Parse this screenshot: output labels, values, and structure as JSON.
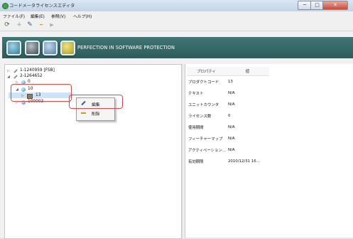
{
  "window": {
    "title": "コードメータライセンスエディタ",
    "min": "─",
    "max": "□",
    "close": "✕"
  },
  "menu": [
    {
      "label": "ファイル(F)"
    },
    {
      "label": "編集(E)"
    },
    {
      "label": "参照(V)"
    },
    {
      "label": "ヘルプ(H)"
    }
  ],
  "toolbar": {
    "refresh": "⟳",
    "add": "+",
    "edit": "✎",
    "remove": "━",
    "run": "▶"
  },
  "banner": {
    "tagline": "PERFECTION IN SOFTWARE PROTECTION",
    "icons": [
      "cmcontainer-icon",
      "firm-item-icon",
      "product-item-icon",
      "settings-icon"
    ]
  },
  "tree": [
    {
      "label": "1-1240959 [FSB]"
    },
    {
      "label": "2-1264652"
    },
    {
      "label": "0"
    },
    {
      "label": "10"
    },
    {
      "label": "13"
    },
    {
      "label": "100003"
    }
  ],
  "context_menu": {
    "edit": "編集",
    "delete": "削除"
  },
  "properties": {
    "header_property": "プロパティ",
    "header_value": "値",
    "rows": [
      {
        "key": "プロダクトコード",
        "value": "13"
      },
      {
        "key": "テキスト",
        "value": "N/A"
      },
      {
        "key": "ユニットカウンタ",
        "value": "N/A"
      },
      {
        "key": "ライセンス数",
        "value": "0"
      },
      {
        "key": "使用期間",
        "value": "N/A"
      },
      {
        "key": "フィーチャーマップ",
        "value": "N/A"
      },
      {
        "key": "アクティベーション...",
        "value": "N/A"
      },
      {
        "key": "有効期限",
        "value": "2010/12/31 16..."
      }
    ]
  }
}
